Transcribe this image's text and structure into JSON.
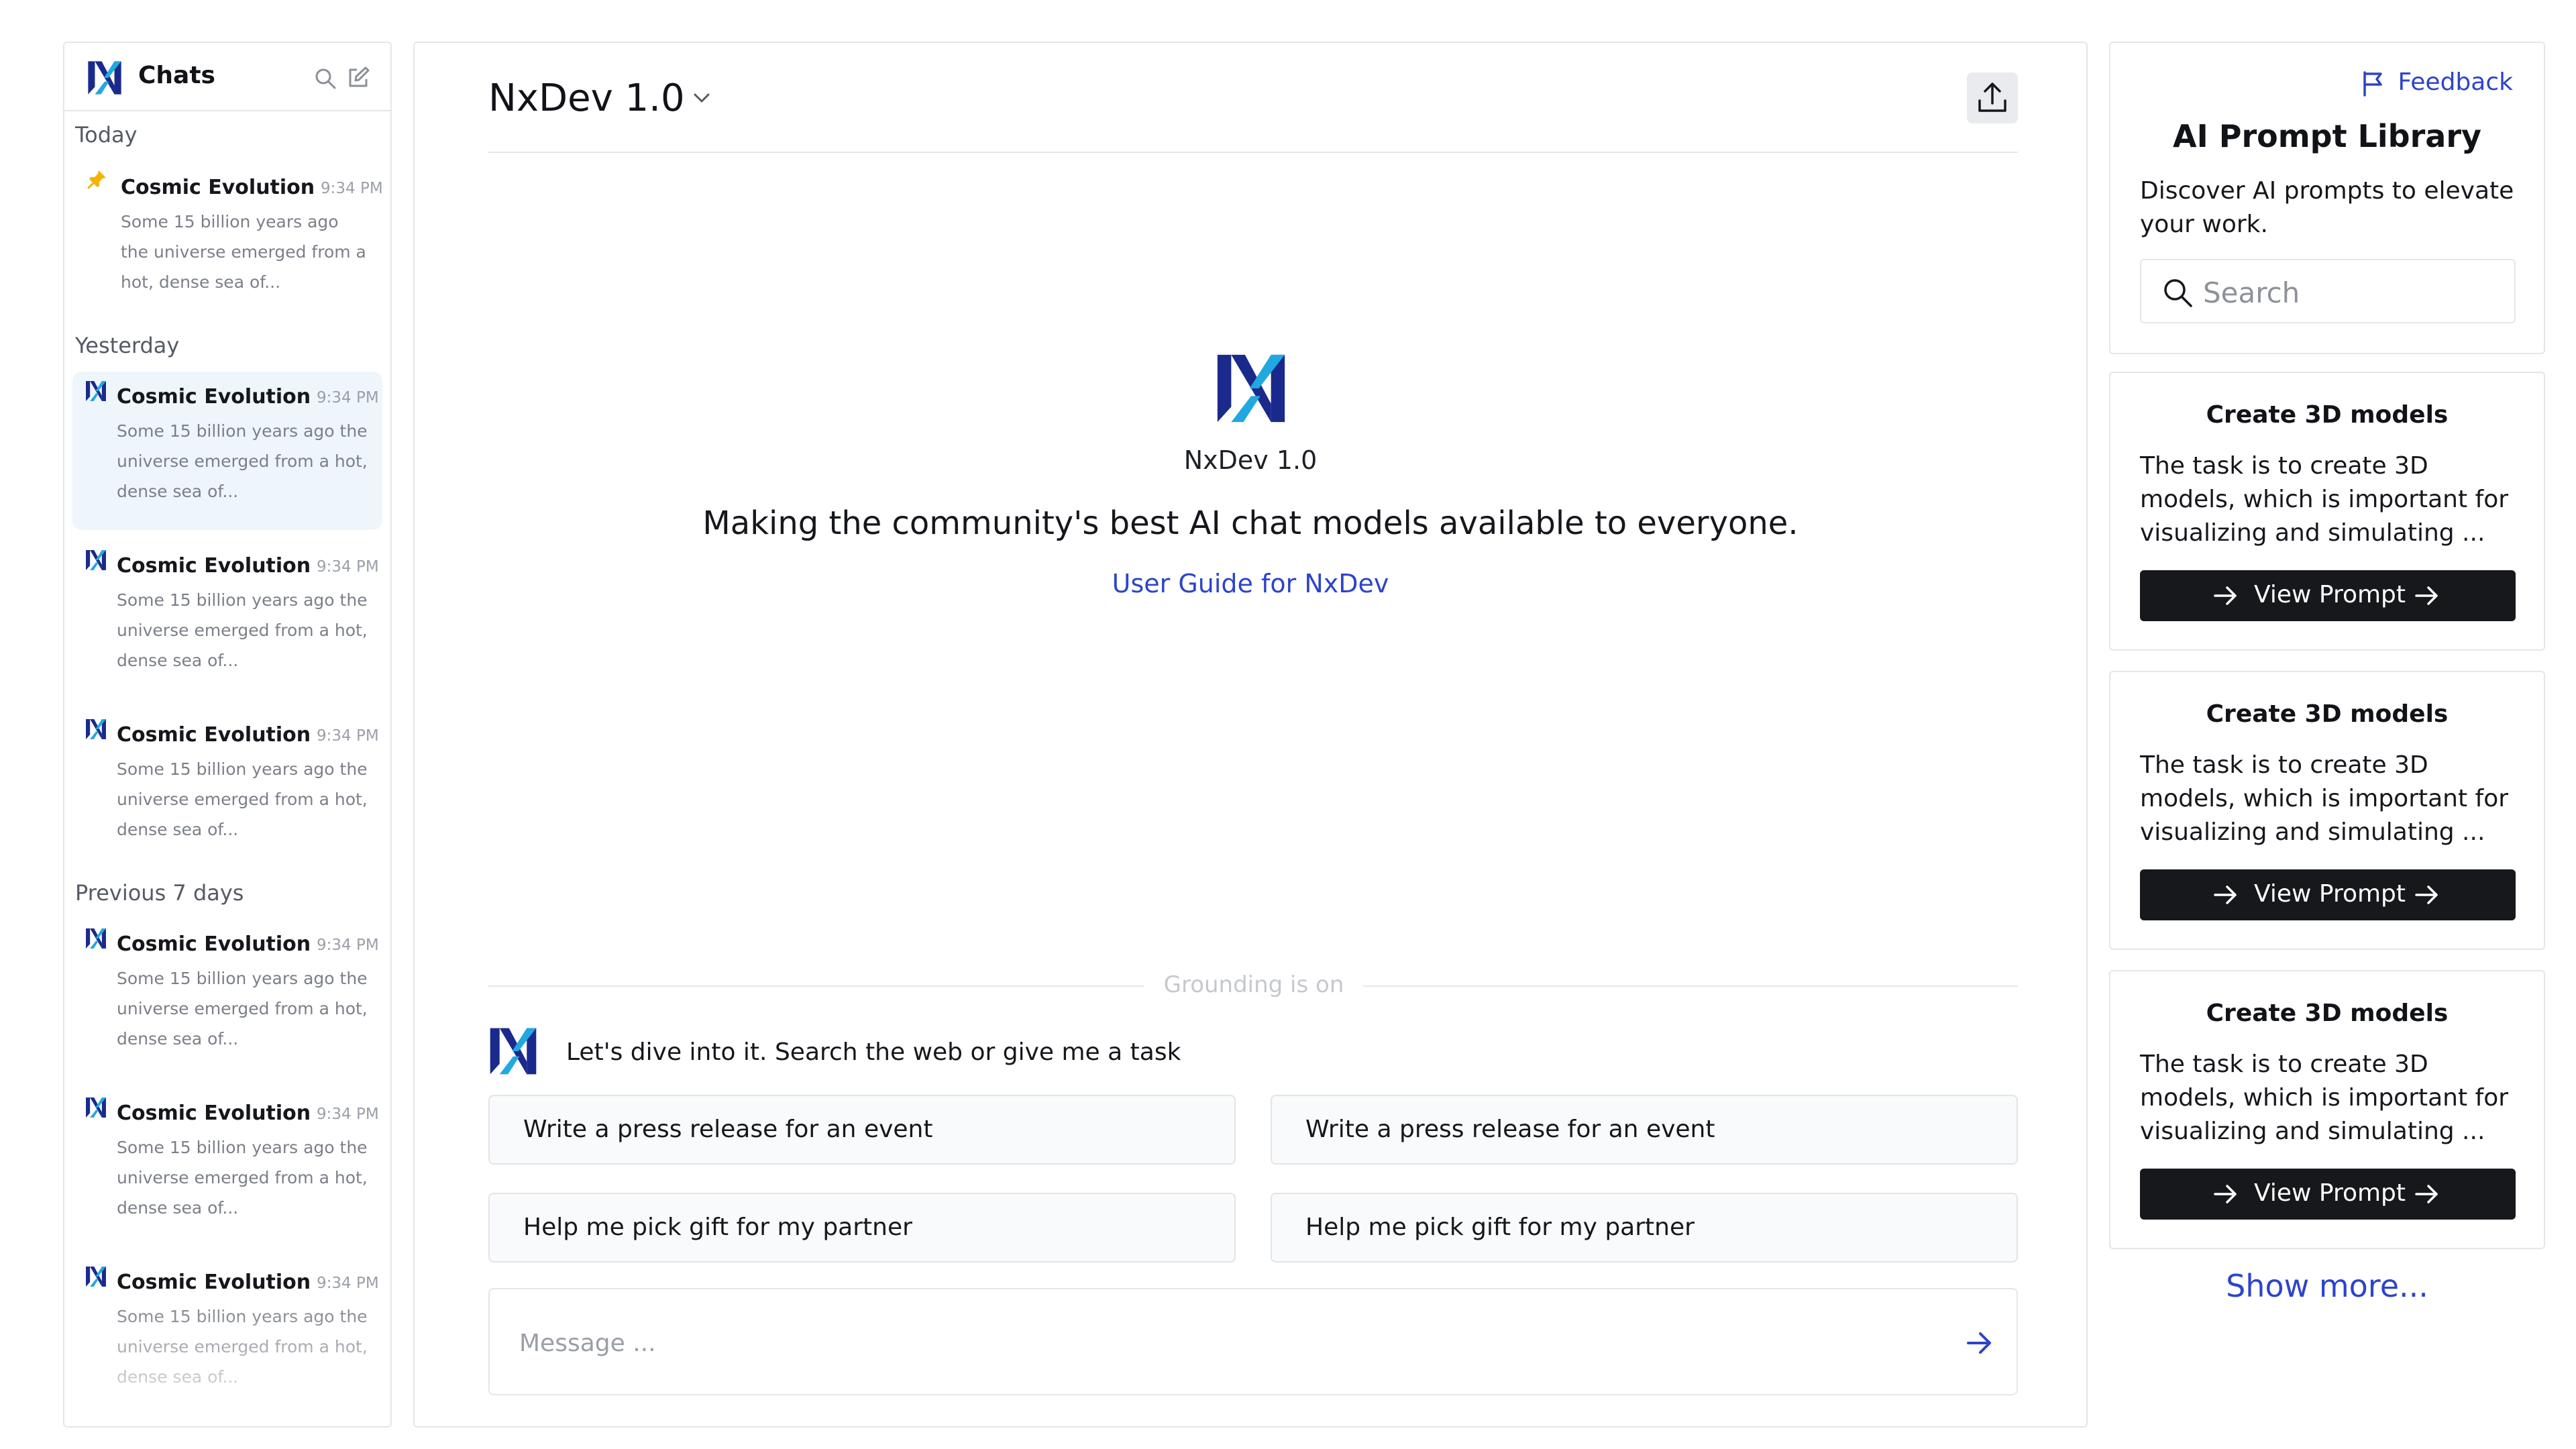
{
  "colors": {
    "brand_dark": "#1a2a8c",
    "brand_light": "#22a8e0",
    "link": "#2d44c9",
    "button_bg": "#16181c",
    "active_chat_bg": "#eef6fb",
    "pin": "#f4b400"
  },
  "sidebar": {
    "title": "Chats",
    "icons": {
      "logo": "nxdev-logo-icon",
      "search": "search-icon",
      "compose": "compose-icon"
    },
    "sections": [
      {
        "label": "Today",
        "chats": [
          {
            "icon": "pin-icon",
            "title": "Cosmic Evolution",
            "time": "9:34 PM",
            "snippet": [
              "Some 15 billion years ago",
              "the universe emerged from a",
              "hot, dense sea of..."
            ]
          }
        ]
      },
      {
        "label": "Yesterday",
        "chats": [
          {
            "icon": "nxdev-logo-icon",
            "title": "Cosmic Evolution",
            "time": "9:34 PM",
            "snippet": [
              "Some 15 billion years ago the",
              "universe emerged from a hot,",
              "dense sea of..."
            ],
            "active": true
          },
          {
            "icon": "nxdev-logo-icon",
            "title": "Cosmic Evolution",
            "time": "9:34 PM",
            "snippet": [
              "Some 15 billion years ago the",
              "universe emerged from a hot,",
              "dense sea of..."
            ]
          },
          {
            "icon": "nxdev-logo-icon",
            "title": "Cosmic Evolution",
            "time": "9:34 PM",
            "snippet": [
              "Some 15 billion years ago the",
              "universe emerged from a hot,",
              "dense sea of..."
            ]
          }
        ]
      },
      {
        "label": "Previous 7 days",
        "chats": [
          {
            "icon": "nxdev-logo-icon",
            "title": "Cosmic Evolution",
            "time": "9:34 PM",
            "snippet": [
              "Some 15 billion years ago the",
              "universe emerged from a hot,",
              "dense sea of..."
            ]
          },
          {
            "icon": "nxdev-logo-icon",
            "title": "Cosmic Evolution",
            "time": "9:34 PM",
            "snippet": [
              "Some 15 billion years ago the",
              "universe emerged from a hot,",
              "dense sea of..."
            ]
          },
          {
            "icon": "nxdev-logo-icon",
            "title": "Cosmic Evolution",
            "time": "9:34 PM",
            "snippet": [
              "Some 15 billion years ago the",
              "universe emerged from a hot,",
              "dense sea of..."
            ]
          }
        ]
      }
    ]
  },
  "main": {
    "model_name": "NxDev 1.0",
    "icons": {
      "chevron": "chevron-down-icon",
      "share": "upload-share-icon",
      "send": "send-arrow-icon"
    },
    "hero": {
      "name": "NxDev 1.0",
      "tagline": "Making the community's best AI chat models available to everyone.",
      "link": "User Guide for NxDev"
    },
    "grounding": "Grounding is on",
    "assistant_message": "Let's dive into it. Search the web or give me a task",
    "suggestions": [
      "Write a press release for an event",
      "Write a press release for an event",
      "Help me pick gift for my partner",
      "Help me pick gift for my partner"
    ],
    "composer": {
      "placeholder": "Message ...",
      "value": ""
    }
  },
  "library": {
    "feedback": "Feedback",
    "feedback_icon": "flag-icon",
    "title": "AI Prompt Library",
    "description": "Discover AI prompts to elevate your work.",
    "search_placeholder": "Search",
    "search_icon": "search-icon",
    "cards": [
      {
        "title": "Create 3D models",
        "description": "The task is to create 3D models, which is important for visualizing and simulating ...",
        "button": "View Prompt"
      },
      {
        "title": "Create 3D models",
        "description": "The task is to create 3D models, which is important for visualizing and simulating ...",
        "button": "View Prompt"
      },
      {
        "title": "Create 3D models",
        "description": "The task is to create 3D models, which is important for visualizing and simulating ...",
        "button": "View Prompt"
      }
    ],
    "show_more": "Show more..."
  }
}
